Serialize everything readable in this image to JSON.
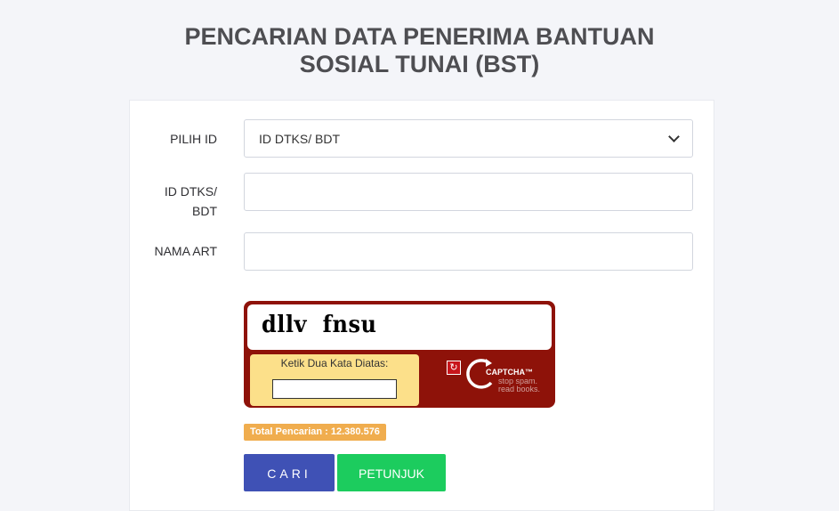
{
  "header": {
    "title_line1": "PENCARIAN DATA PENERIMA BANTUAN",
    "title_line2": "SOSIAL TUNAI (BST)"
  },
  "form": {
    "pilih_id": {
      "label": "PILIH ID",
      "selected_value": "ID DTKS/ BDT"
    },
    "id_dtks": {
      "label_line1": "ID DTKS/",
      "label_line2": "BDT",
      "value": ""
    },
    "nama_art": {
      "label": "NAMA ART",
      "value": ""
    }
  },
  "captcha": {
    "challenge_words": "dllv  fnsu",
    "instruction": "Ketik Dua Kata Diatas:",
    "input_value": "",
    "brand_name": "CAPTCHA™",
    "tagline_line1": "stop spam.",
    "tagline_line2": "read books."
  },
  "stats": {
    "total_label": "Total Pencarian : 12.380.576"
  },
  "buttons": {
    "cari_label": "CARI",
    "petunjuk_label": "PETUNJUK"
  },
  "colors": {
    "cari_button": "#3f51b5",
    "petunjuk_button": "#1ccc5e",
    "total_badge": "#f0ad4e",
    "captcha_frame": "#8e1209",
    "captcha_entry_bg": "#fce08a"
  }
}
